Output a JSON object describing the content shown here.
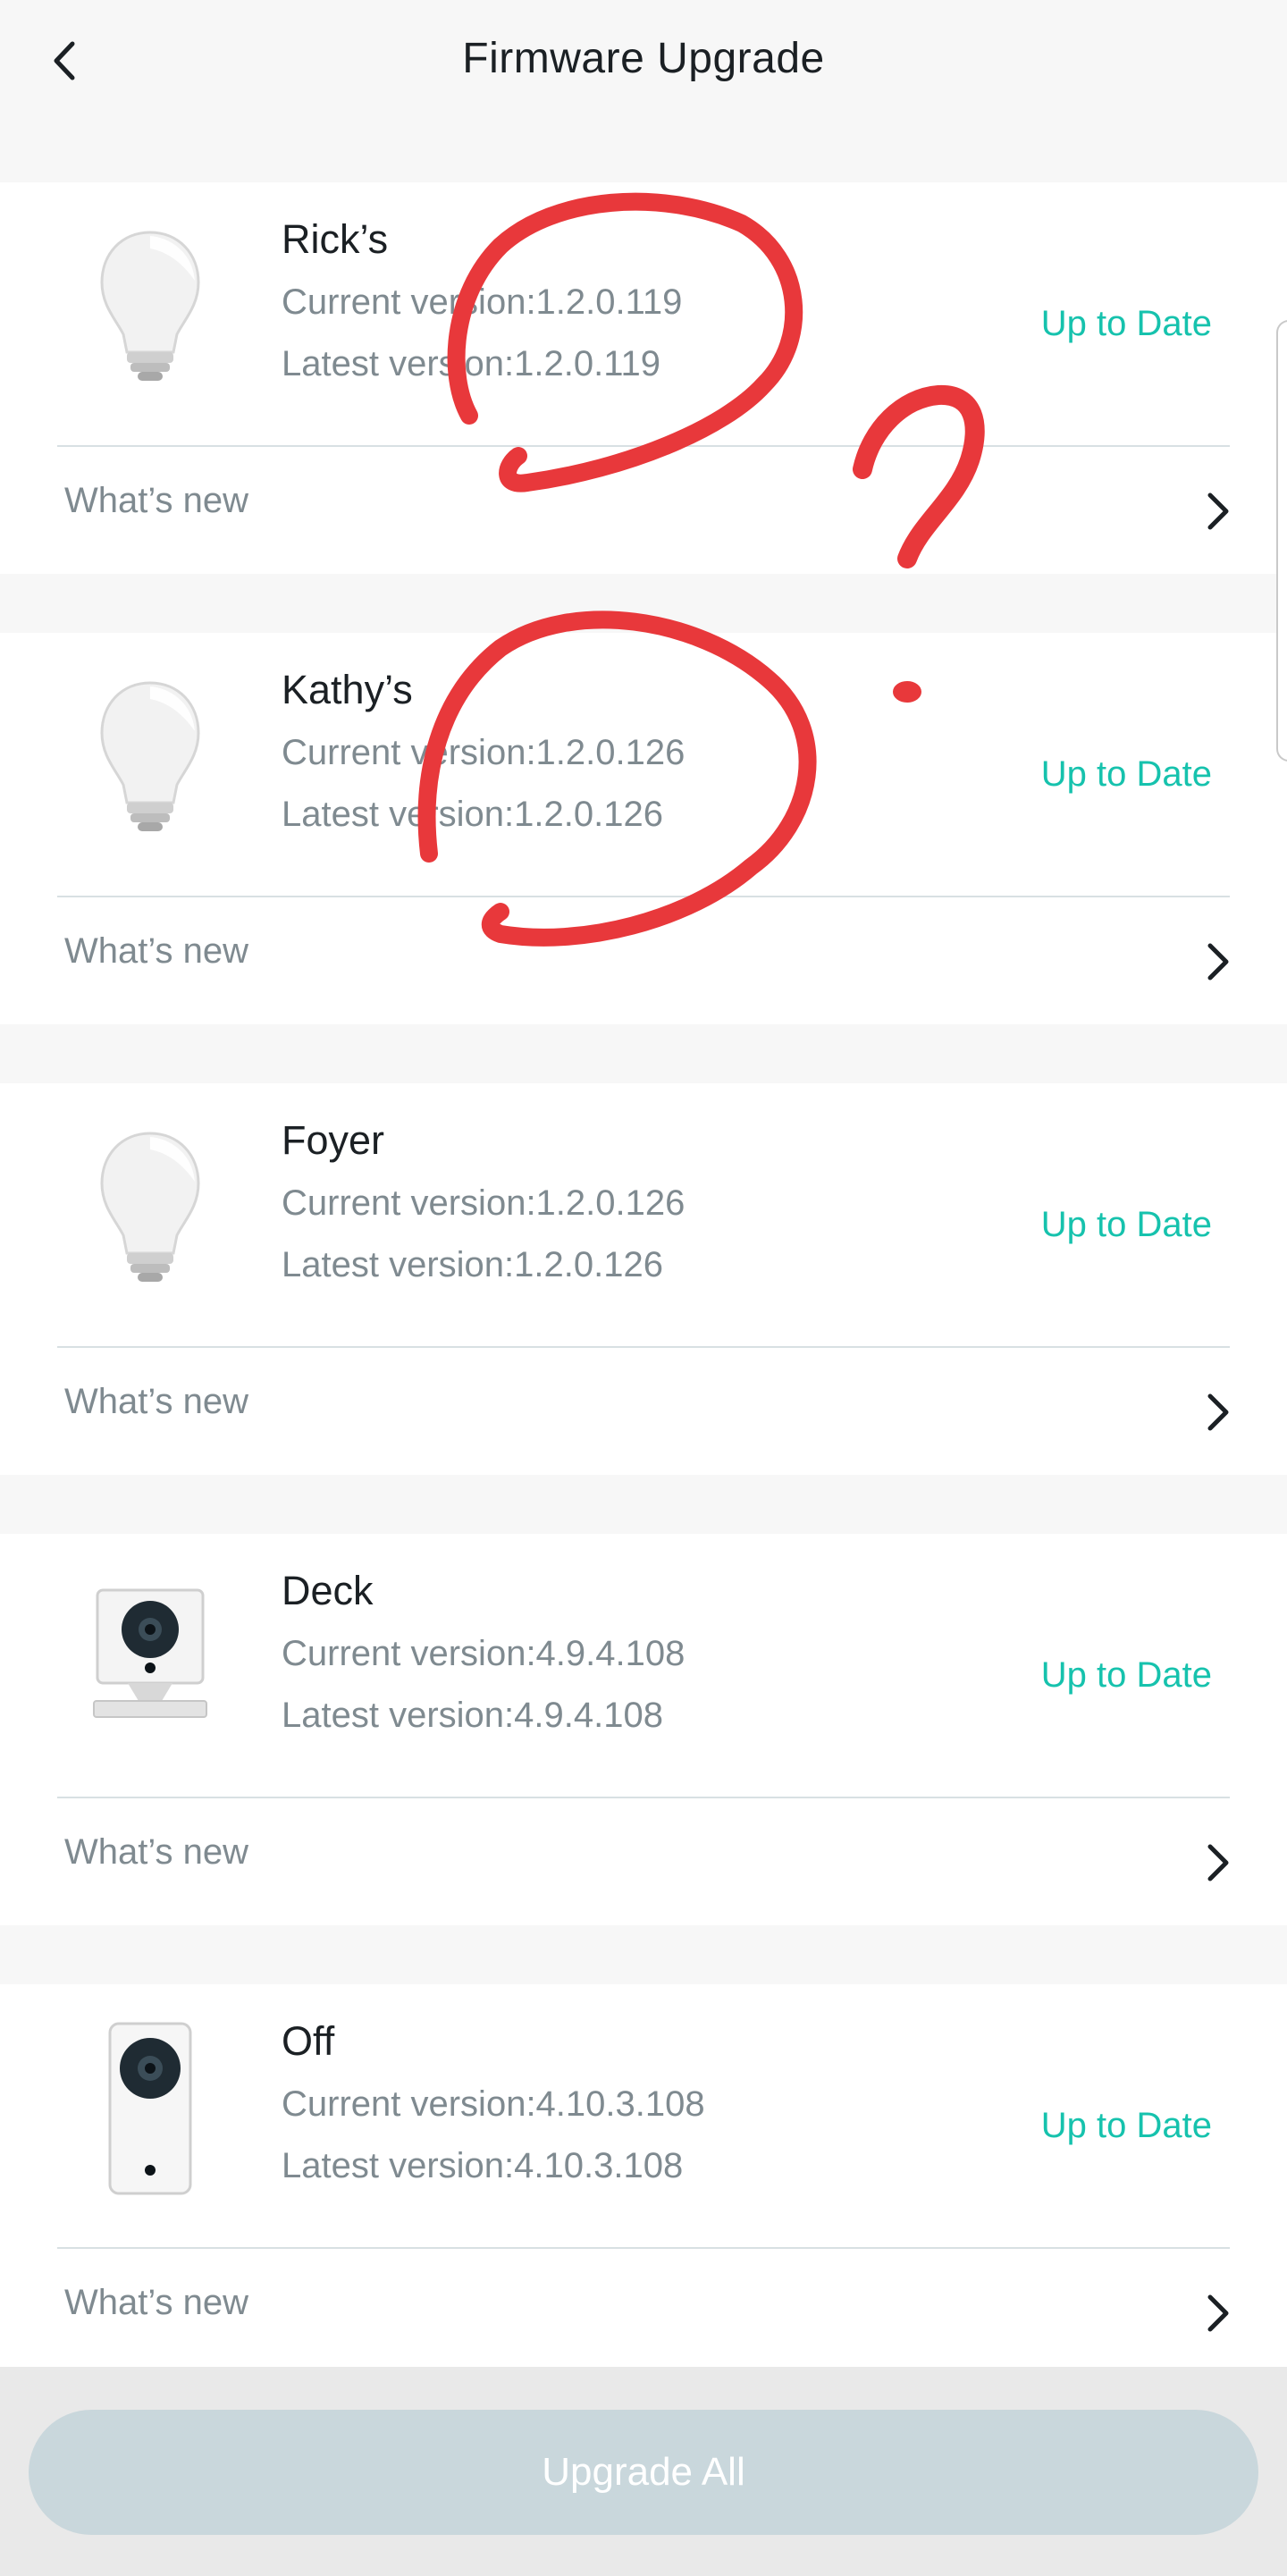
{
  "header": {
    "title": "Firmware Upgrade",
    "back_icon": "chevron-left-icon"
  },
  "devices": [
    {
      "name": "Rick’s",
      "current": "Current version:1.2.0.119",
      "latest": "Latest version:1.2.0.119",
      "status": "Up to Date",
      "whats_new": "What’s new",
      "icon": "bulb-icon"
    },
    {
      "name": "Kathy’s",
      "current": "Current version:1.2.0.126",
      "latest": "Latest version:1.2.0.126",
      "status": "Up to Date",
      "whats_new": "What’s new",
      "icon": "bulb-icon"
    },
    {
      "name": "Foyer",
      "current": "Current version:1.2.0.126",
      "latest": "Latest version:1.2.0.126",
      "status": "Up to Date",
      "whats_new": "What’s new",
      "icon": "bulb-icon"
    },
    {
      "name": "Deck",
      "current": "Current version:4.9.4.108",
      "latest": "Latest version:4.9.4.108",
      "status": "Up to Date",
      "whats_new": "What’s new",
      "icon": "camera-icon"
    },
    {
      "name": "Off",
      "current": "Current version:4.10.3.108",
      "latest": "Latest version:4.10.3.108",
      "status": "Up to Date",
      "whats_new": "What’s new",
      "icon": "camera-pan-icon"
    }
  ],
  "footer": {
    "upgrade_all_label": "Upgrade All"
  },
  "colors": {
    "accent": "#16c2ad",
    "annotation": "#e8383b",
    "button_disabled": "#c9d7dc"
  }
}
